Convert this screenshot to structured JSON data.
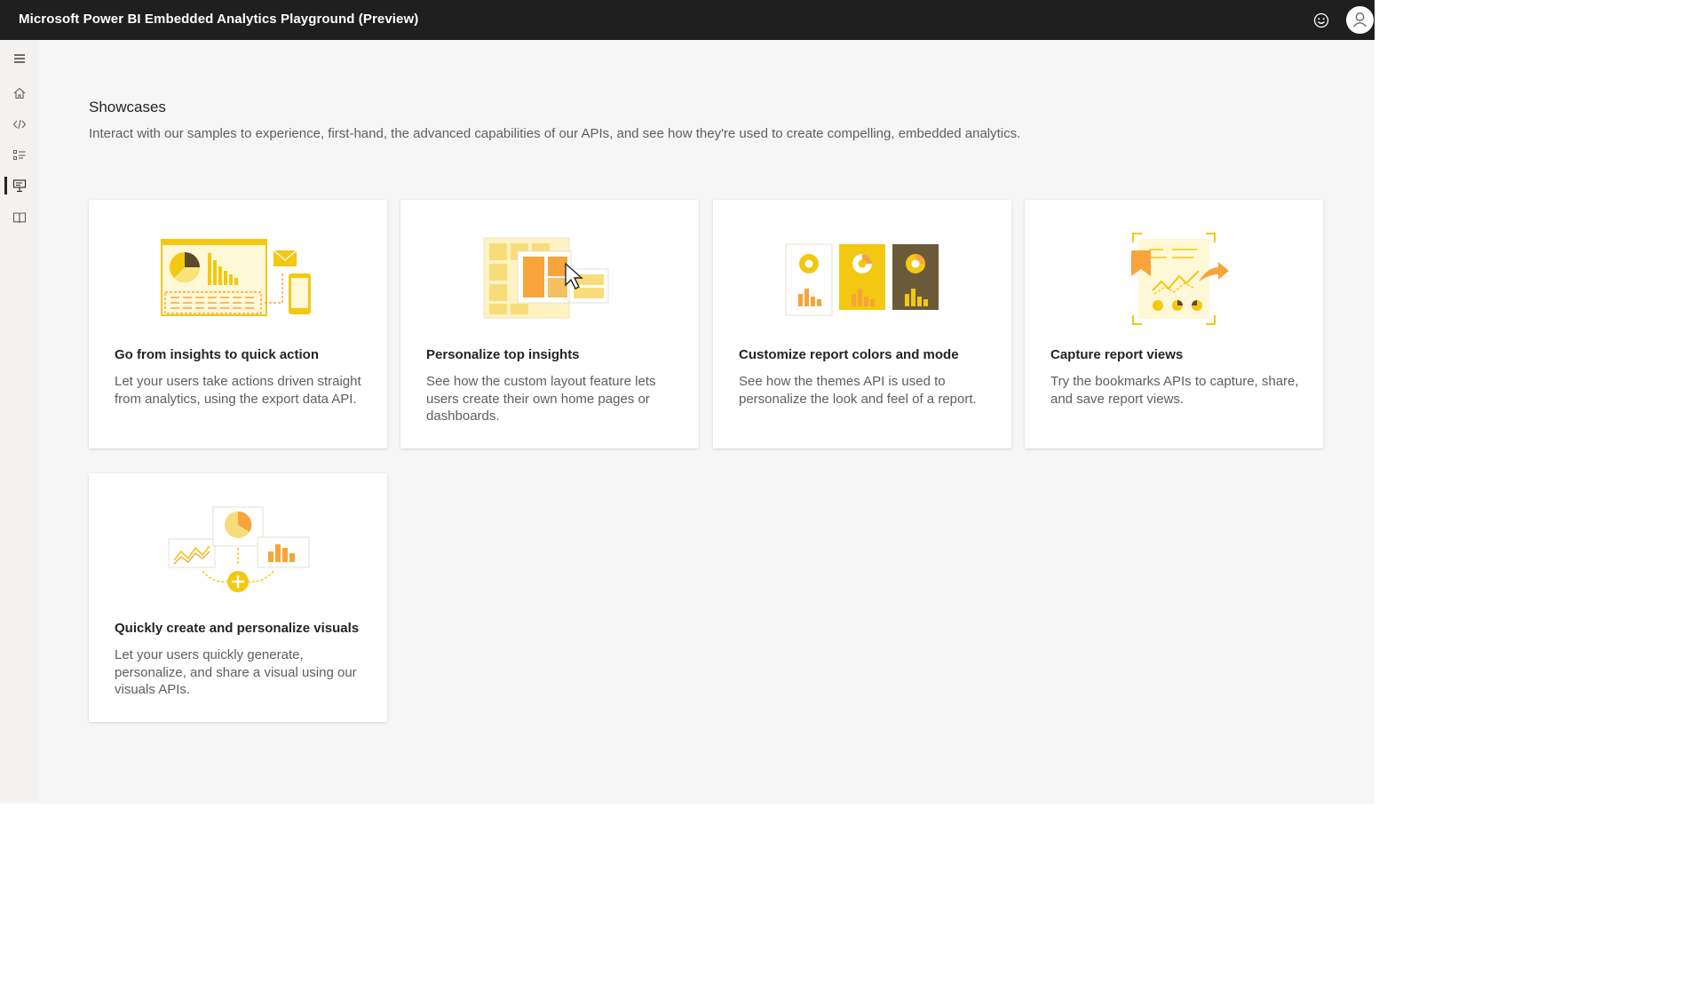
{
  "header": {
    "title": "Microsoft Power BI Embedded Analytics Playground (Preview)",
    "icons": [
      "feedback-smiley-icon",
      "user-avatar-icon"
    ]
  },
  "sidebar": {
    "items": [
      {
        "icon": "hamburger-menu-icon",
        "active": false
      },
      {
        "icon": "home-icon",
        "active": false
      },
      {
        "icon": "code-icon",
        "active": false
      },
      {
        "icon": "list-icon",
        "active": false
      },
      {
        "icon": "showcase-presentation-icon",
        "active": true
      },
      {
        "icon": "learning-book-icon",
        "active": false
      }
    ]
  },
  "main": {
    "title": "Showcases",
    "subtitle": "Interact with our samples to experience, first-hand, the advanced capabilities of our APIs, and see how they're used to create compelling, embedded analytics.",
    "cards": [
      {
        "title": "Go from insights to quick action",
        "description": "Let your users take actions driven straight from analytics, using the export data API.",
        "illustration": "report-email-phone-illustration"
      },
      {
        "title": "Personalize top insights",
        "description": "See how the custom layout feature lets users create their own home pages or dashboards.",
        "illustration": "layout-grid-cursor-illustration"
      },
      {
        "title": "Customize report colors and mode",
        "description": "See how the themes API is used to personalize the look and feel of a report.",
        "illustration": "themes-three-cards-illustration"
      },
      {
        "title": "Capture report views",
        "description": "Try the bookmarks APIs to capture, share, and save report views.",
        "illustration": "bookmark-capture-illustration"
      },
      {
        "title": "Quickly create and personalize visuals",
        "description": "Let your users quickly generate, personalize, and share a visual using our visuals APIs.",
        "illustration": "create-visual-plus-illustration"
      }
    ]
  },
  "colors": {
    "topbar": "#1f1f1f",
    "accent_yellow": "#f2c811",
    "accent_orange": "#f7a43b",
    "dark_brown": "#6b5a3a"
  }
}
